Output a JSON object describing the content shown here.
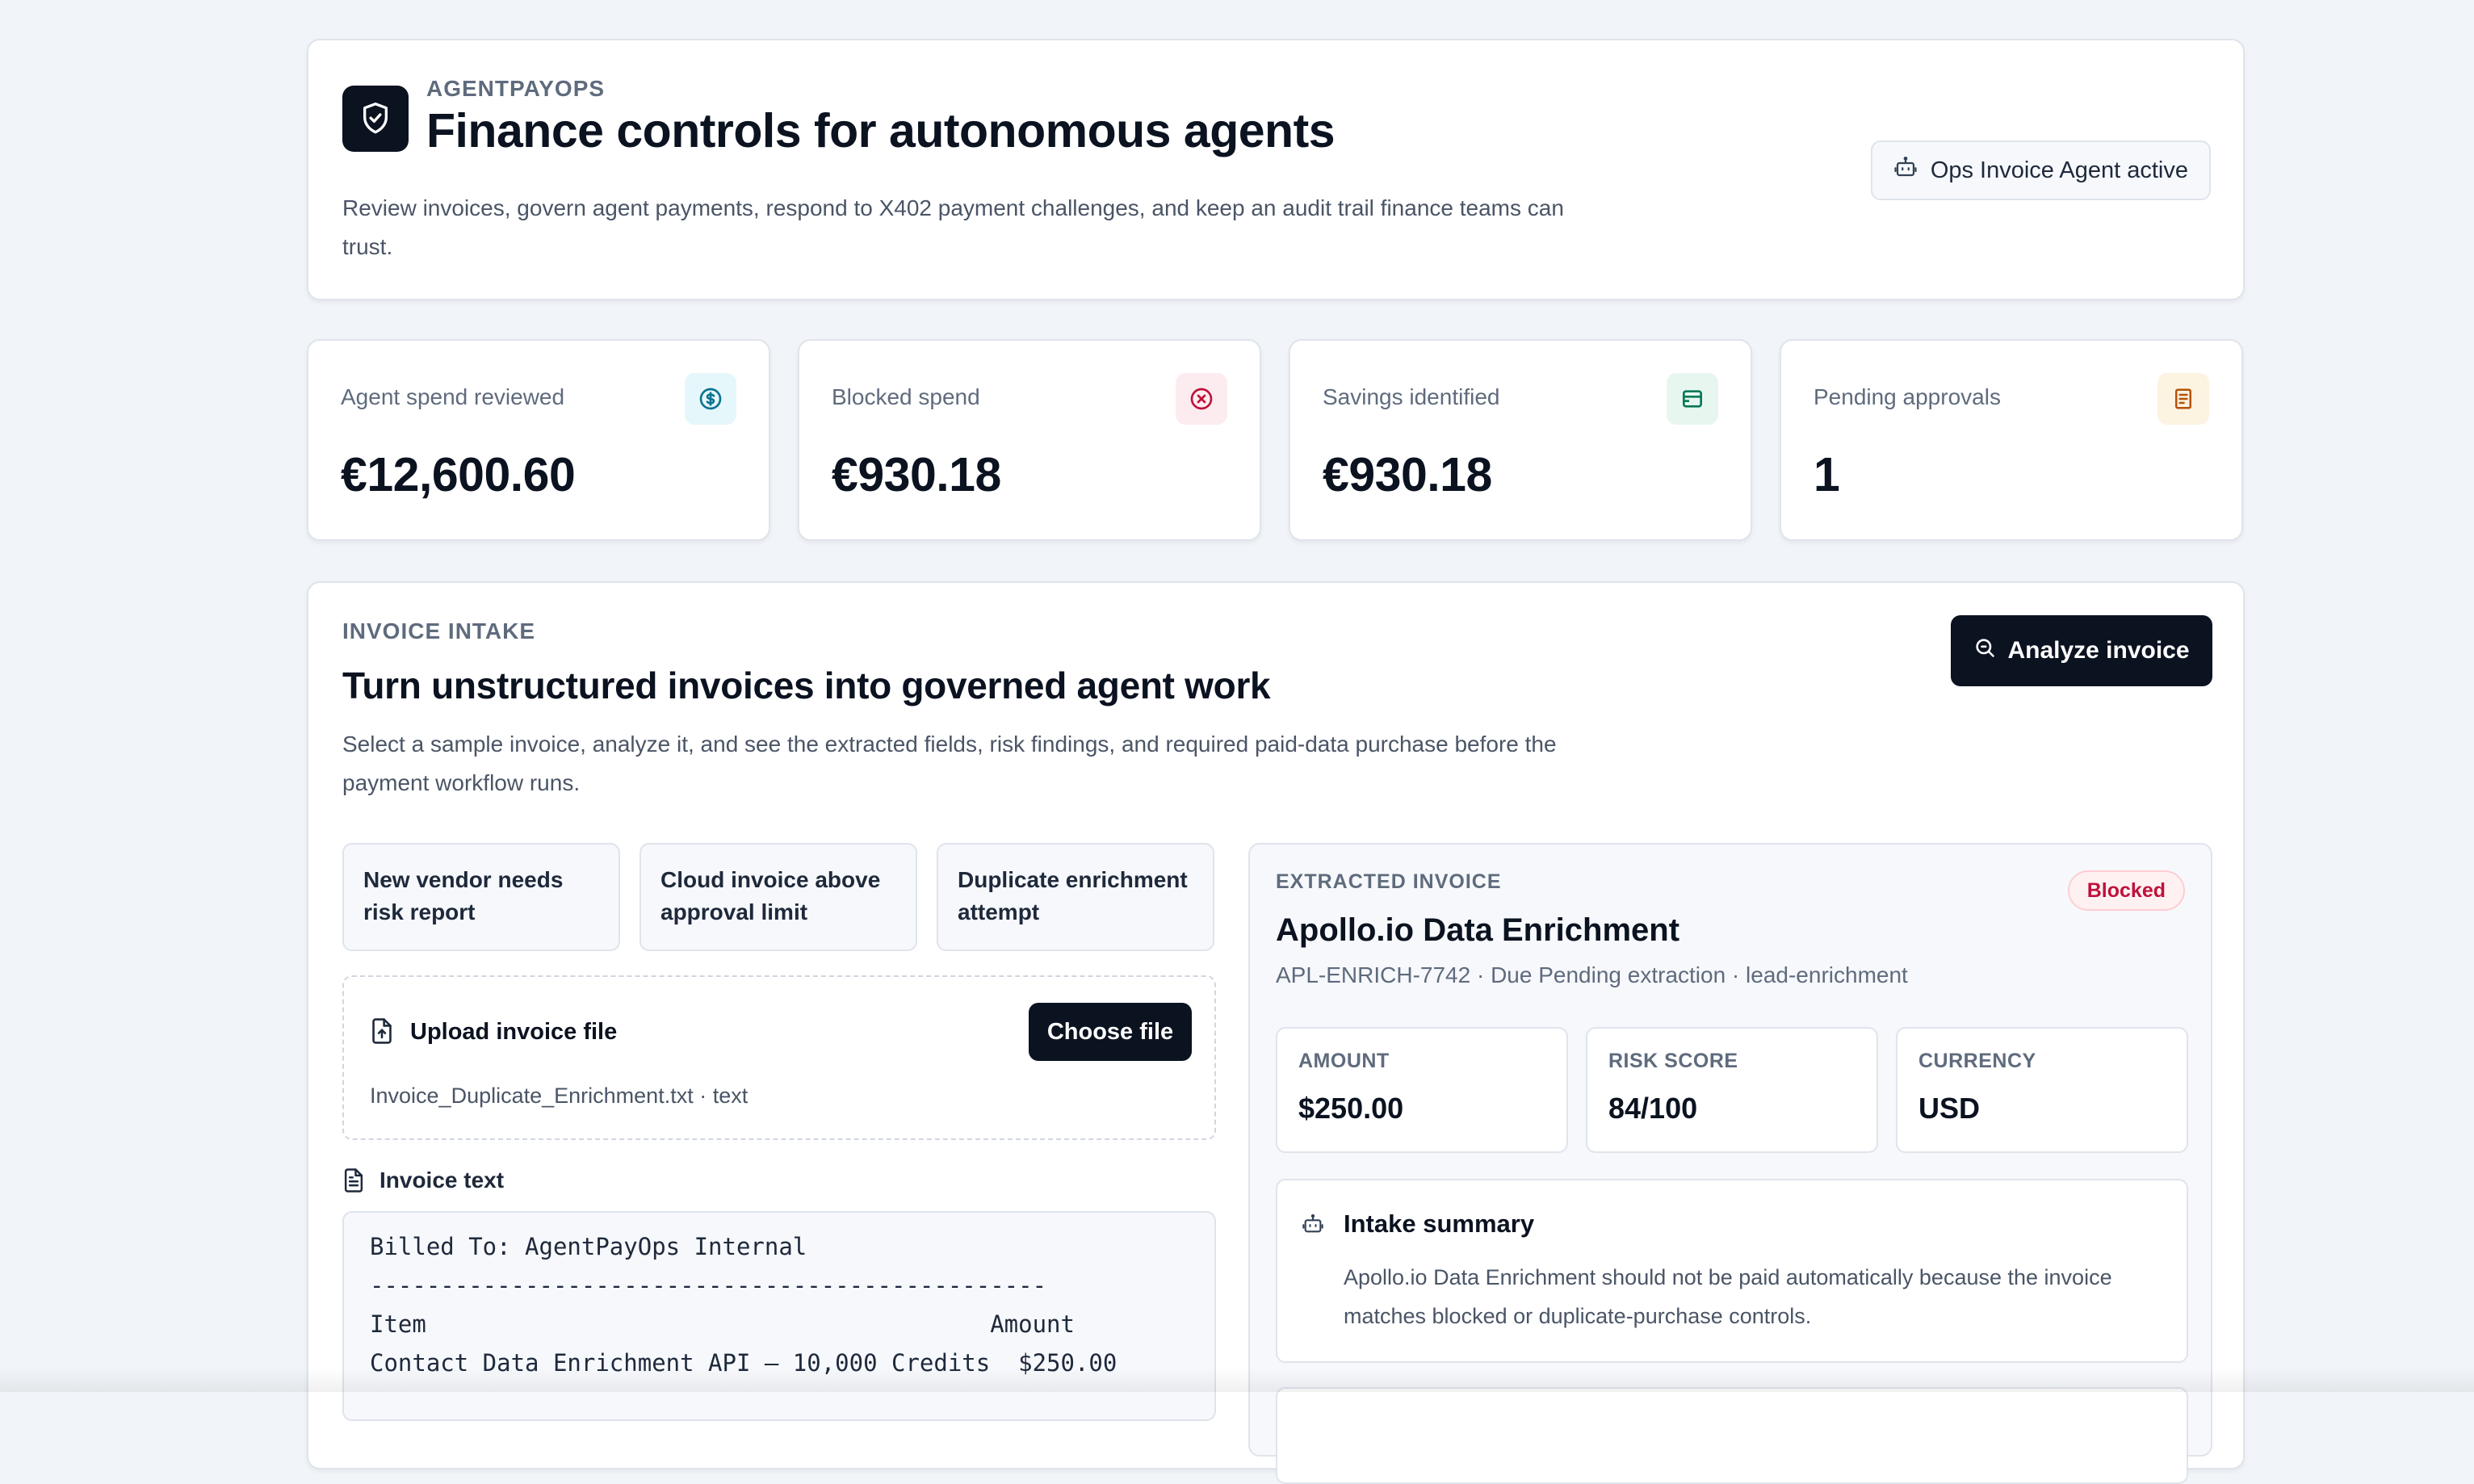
{
  "header": {
    "eyebrow": "AGENTPAYOPS",
    "title": "Finance controls for autonomous agents",
    "description": "Review invoices, govern agent payments, respond to X402 payment challenges, and keep an audit trail finance teams can trust.",
    "agent_status": "Ops Invoice Agent active"
  },
  "stats": [
    {
      "label": "Agent spend reviewed",
      "value": "€12,600.60",
      "icon": "dollar-circle-icon",
      "color": "#0e7490",
      "bg": "#e6f7fb"
    },
    {
      "label": "Blocked spend",
      "value": "€930.18",
      "icon": "x-circle-icon",
      "color": "#be123c",
      "bg": "#fdecef"
    },
    {
      "label": "Savings identified",
      "value": "€930.18",
      "icon": "wallet-icon",
      "color": "#047857",
      "bg": "#e7f7ef"
    },
    {
      "label": "Pending approvals",
      "value": "1",
      "icon": "receipt-icon",
      "color": "#b45309",
      "bg": "#fdf3e1"
    }
  ],
  "intake": {
    "eyebrow": "INVOICE INTAKE",
    "title": "Turn unstructured invoices into governed agent work",
    "description": "Select a sample invoice, analyze it, and see the extracted fields, risk findings, and required paid-data purchase before the payment workflow runs.",
    "analyze_label": "Analyze invoice",
    "samples": [
      {
        "label": "New vendor needs risk report"
      },
      {
        "label": "Cloud invoice above approval limit"
      },
      {
        "label": "Duplicate enrichment attempt"
      }
    ],
    "upload": {
      "title": "Upload invoice file",
      "button": "Choose file",
      "file": "Invoice_Duplicate_Enrichment.txt · text"
    },
    "invoice_text_label": "Invoice text",
    "invoice_text": "Billed To: AgentPayOps Internal\n------------------------------------------------\nItem                                        Amount\nContact Data Enrichment API – 10,000 Credits  $250.00"
  },
  "extracted": {
    "eyebrow": "EXTRACTED INVOICE",
    "status": "Blocked",
    "vendor": "Apollo.io Data Enrichment",
    "meta": "APL-ENRICH-7742 · Due Pending extraction · lead-enrichment",
    "fields": [
      {
        "label": "AMOUNT",
        "value": "$250.00"
      },
      {
        "label": "RISK SCORE",
        "value": "84/100"
      },
      {
        "label": "CURRENCY",
        "value": "USD"
      }
    ],
    "summary_title": "Intake summary",
    "summary_text": "Apollo.io Data Enrichment should not be paid automatically because the invoice matches blocked or duplicate-purchase controls."
  }
}
